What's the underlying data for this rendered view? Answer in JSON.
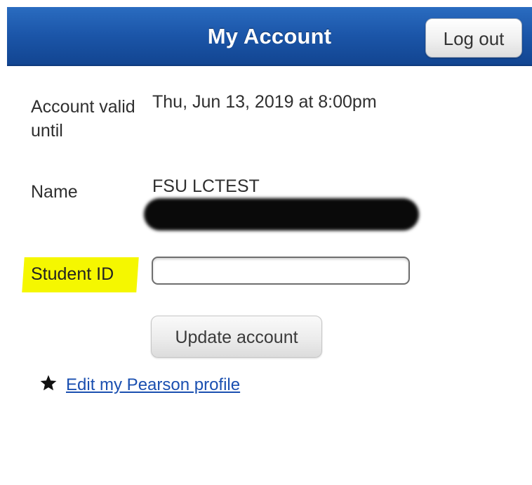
{
  "header": {
    "title": "My Account",
    "logout_label": "Log out"
  },
  "account": {
    "valid_label": "Account valid until",
    "valid_value": "Thu, Jun 13, 2019 at 8:00pm",
    "name_label": "Name",
    "name_value": "FSU LCTEST"
  },
  "student_id": {
    "label": "Student ID",
    "value": "",
    "highlight_color": "#f5f700"
  },
  "actions": {
    "update_label": "Update account",
    "profile_link_label": "Edit my Pearson profile",
    "profile_icon": "star-icon"
  },
  "colors": {
    "header_blue": "#1b55a8",
    "link_blue": "#1a4fb0"
  }
}
